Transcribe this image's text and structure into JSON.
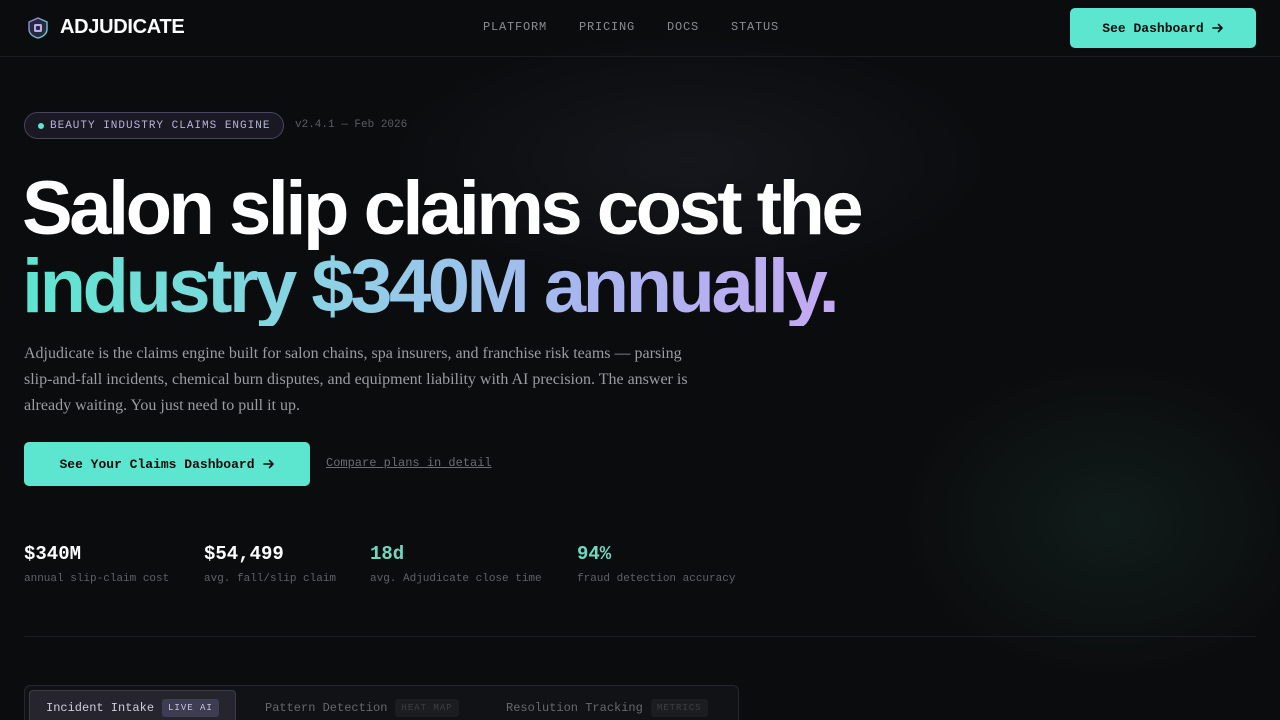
{
  "nav": {
    "brand": "ADJUDICATE",
    "links": [
      "PLATFORM",
      "PRICING",
      "DOCS",
      "STATUS"
    ],
    "cta": "See Dashboard"
  },
  "hero": {
    "badge": "BEAUTY INDUSTRY CLAIMS ENGINE",
    "version": "v2.4.1 — Feb 2026",
    "headline_line1": "Salon slip claims cost the",
    "headline_line2": "industry $340M annually.",
    "subtext": "Adjudicate is the claims engine built for salon chains, spa insurers, and franchise risk teams — parsing slip-and-fall incidents, chemical burn disputes, and equipment liability with AI precision. The answer is already waiting. You just need to pull it up.",
    "cta_primary": "See Your Claims Dashboard",
    "cta_secondary": "Compare plans in detail"
  },
  "stats": [
    {
      "value": "$340M",
      "label": "annual slip-claim cost"
    },
    {
      "value": "$54,499",
      "label": "avg. fall/slip claim"
    },
    {
      "value": "18d",
      "label": "avg. Adjudicate close time"
    },
    {
      "value": "94%",
      "label": "fraud detection accuracy"
    }
  ],
  "tabs": [
    {
      "label": "Incident Intake",
      "pill": "LIVE AI"
    },
    {
      "label": "Pattern Detection",
      "pill": "HEAT MAP"
    },
    {
      "label": "Resolution Tracking",
      "pill": "METRICS"
    }
  ],
  "colors": {
    "accent": "#5de6cf",
    "background": "#0b0c0e",
    "gradient_end": "#c4a9f2"
  },
  "icons": [
    "brand-shield-icon",
    "arrow-right-icon"
  ]
}
